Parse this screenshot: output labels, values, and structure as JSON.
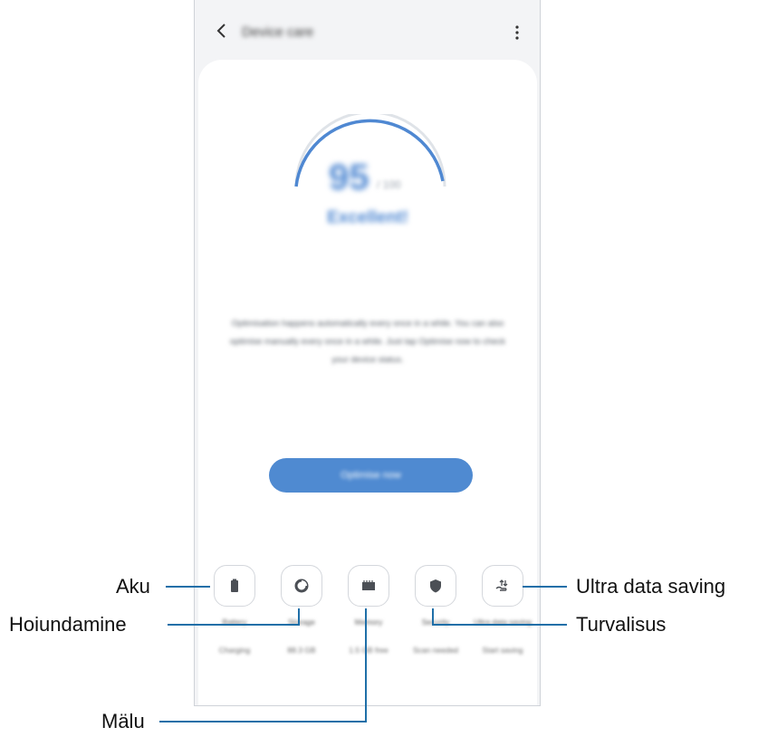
{
  "header": {
    "title": "Device care",
    "back_icon": "chevron-left-icon",
    "more_icon": "more-vertical-icon"
  },
  "score": {
    "value": "95",
    "max": "/ 100",
    "status": "Excellent!",
    "progress_fraction": 0.95
  },
  "description": "Optimisation happens automatically every once in a while. You can also optimise manually every once in a while. Just tap Optimise now to check your device status.",
  "optimise_button": "Optimise now",
  "tiles": [
    {
      "label": "Battery",
      "sub": "Charging",
      "icon": "battery-icon"
    },
    {
      "label": "Storage",
      "sub": "88.3 GB",
      "icon": "storage-pie-icon"
    },
    {
      "label": "Memory",
      "sub": "1.5 GB free",
      "icon": "memory-chip-icon"
    },
    {
      "label": "Security",
      "sub": "Scan needed",
      "icon": "shield-icon"
    },
    {
      "label": "Ultra data saving",
      "sub": "Start saving",
      "icon": "data-saving-icon"
    }
  ],
  "callouts": {
    "aku": "Aku",
    "hoiundamine": "Hoiundamine",
    "malu": "Mälu",
    "ultra": "Ultra data saving",
    "turvalisus": "Turvalisus"
  },
  "colors": {
    "accent": "#4f88d2",
    "screen_background": "#f3f4f6",
    "card": "#ffffff",
    "callout_line": "#1f6fa8"
  }
}
